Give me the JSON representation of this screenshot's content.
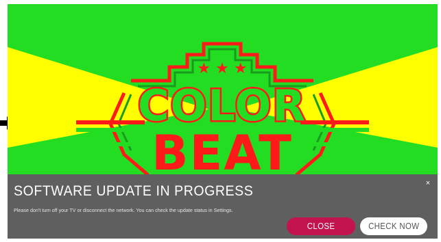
{
  "artwork": {
    "title_line1": "COLOR",
    "title_line2": "BEAT",
    "stars": "★ ★ ★",
    "colors": {
      "yellow": "#ffff00",
      "green": "#22dd22",
      "red": "#ff1a1a",
      "dark_green": "#1a9b20"
    }
  },
  "notice": {
    "title": "SOFTWARE UPDATE IN PROGRESS",
    "message": "Please don't turn off your TV or disconnect the network. You can check the update status in Settings.",
    "close_icon": "×",
    "close_button_label": "CLOSE",
    "check_button_label": "CHECK NOW",
    "colors": {
      "panel_bg": "#5f5f5f",
      "close_button_bg": "#c3134f",
      "check_button_bg": "#ffffff"
    }
  }
}
